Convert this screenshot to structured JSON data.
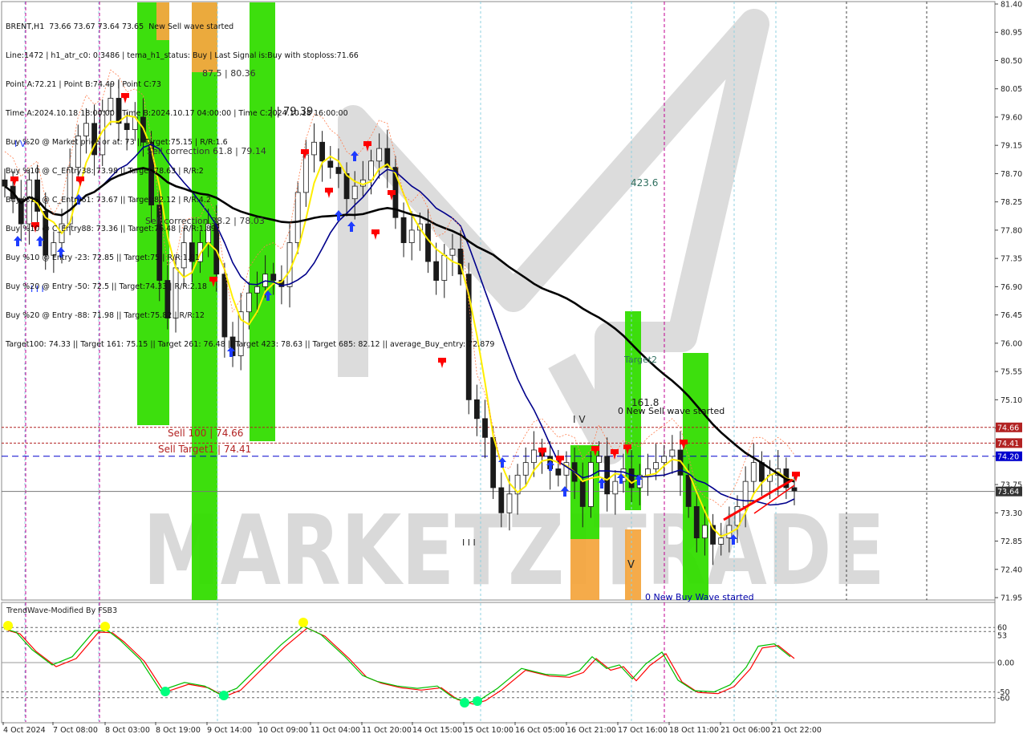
{
  "header": {
    "symbol_line": "BRENT,H1",
    "ohlc_overlay": "73.66 73.67 73.64 73.65",
    "signal_text": "New Sell wave started",
    "info_lines": [
      "Line:1472 | h1_atr_c0: 0.3486 | tema_h1_status: Buy | Last Signal is:Buy with stoploss:71.66",
      "Point A:72.21 | Point B:74.49 | Point C:73",
      "Time A:2024.10.18 18:00:00 | Time B:2024.10.17 04:00:00 | Time C:2024.10.18 16:00:00",
      "Buy %20 @ Market price or at: 73 || Target:75.15 | R/R:1.6",
      "Buy %10 @ C_Entry38: 73.98 || Target:78.63 | R/R:2",
      "Buy %10 @ C_Entry61: 73.67 || Target:82.12 | R/R:4.2",
      "Buy %10 @ C_Entry88: 73.36 || Target:76.48 | R/R:1.89",
      "Buy %10 @ Entry -23: 72.85 || Target:75 | R/R:1.81",
      "Buy %20 @ Entry -50: 72.5 || Target:74.33 | R/R:2.18",
      "Buy %20 @ Entry -88: 71.98 || Target:75.82 | R/R:12",
      "Target100: 74.33 || Target 161: 75.15 || Target 261: 76.48 || Target 423: 78.63 || Target 685: 82.12 || average_Buy_entry: 72.879"
    ]
  },
  "annotations": {
    "a1": "87.5 | 80.36",
    "a2": "| | 79.39",
    "a3": "Sell correction 61.8 | 79.14",
    "a4": "Sell correction 38.2 | 78.03",
    "a5": "423.6",
    "a6": "Target2",
    "a7": "161.8",
    "a8": "0 New Sell wave started",
    "a9": "Sell 100 | 74.66",
    "a10": "Sell Target1 | 74.41",
    "a11": "0 New Buy Wave started",
    "a12": "I V",
    "a13": "I I I",
    "a14": "V",
    "a15": "I V",
    "a16": "I I I"
  },
  "watermark": "MARKETZITRADE",
  "indicator": {
    "title": "TrendWave-Modified By FSB3",
    "levels": [
      "60",
      "53",
      "0.00",
      "-50",
      "-60"
    ]
  },
  "colors": {
    "bull_candle": "#1a1a1a",
    "bear_candle": "#1a1a1a",
    "ma_fast": "#ffff00",
    "ma_mid": "#00008b",
    "ma_slow": "#000000",
    "green_zone": "#00cc00",
    "orange_zone": "#f4a640",
    "level_red": "#b22222",
    "level_blue": "#0000cd",
    "osc_green": "#00c000",
    "osc_red": "#ff0000"
  },
  "chart_data": {
    "type": "line",
    "title": "BRENT,H1",
    "y_axis_labels": [
      "81.40",
      "80.95",
      "80.50",
      "80.05",
      "79.60",
      "79.15",
      "78.70",
      "78.25",
      "77.80",
      "77.35",
      "76.90",
      "76.45",
      "76.00",
      "75.55",
      "75.10",
      "74.65",
      "74.20",
      "73.75",
      "73.30",
      "72.85",
      "72.40",
      "71.95"
    ],
    "ylim": [
      71.95,
      81.4
    ],
    "x_axis_labels": [
      "4 Oct 2024",
      "7 Oct 08:00",
      "8 Oct 03:00",
      "8 Oct 19:00",
      "9 Oct 14:00",
      "10 Oct 09:00",
      "11 Oct 04:00",
      "11 Oct 20:00",
      "14 Oct 15:00",
      "15 Oct 10:00",
      "16 Oct 05:00",
      "16 Oct 21:00",
      "17 Oct 16:00",
      "18 Oct 11:00",
      "21 Oct 06:00",
      "21 Oct 22:00"
    ],
    "price_tags": [
      {
        "label": "74.66",
        "value": 74.66,
        "color": "#b22222"
      },
      {
        "label": "74.41",
        "value": 74.41,
        "color": "#b22222"
      },
      {
        "label": "74.20",
        "value": 74.2,
        "color": "#0000cd"
      },
      {
        "label": "73.64",
        "value": 73.64,
        "color": "#333333"
      }
    ],
    "close_series": [
      78.5,
      78.3,
      77.9,
      78.6,
      78.1,
      77.4,
      77.6,
      77.9,
      78.8,
      79.3,
      79.5,
      79.0,
      79.7,
      79.9,
      79.5,
      79.4,
      79.6,
      79.2,
      78.2,
      77.0,
      76.4,
      77.2,
      77.6,
      77.3,
      77.6,
      77.9,
      77.1,
      76.1,
      75.8,
      76.5,
      76.8,
      76.9,
      77.1,
      77.0,
      76.9,
      77.6,
      78.4,
      79.0,
      79.2,
      78.9,
      78.8,
      78.7,
      78.3,
      78.5,
      78.6,
      78.9,
      79.1,
      78.8,
      78.0,
      77.6,
      77.8,
      77.9,
      77.3,
      77.0,
      77.4,
      77.5,
      77.1,
      75.1,
      74.8,
      74.5,
      73.7,
      73.3,
      73.6,
      73.9,
      74.1,
      74.3,
      74.2,
      74.0,
      73.9,
      74.1,
      73.8,
      73.4,
      74.1,
      74.2,
      73.6,
      73.8,
      74.0,
      73.7,
      73.9,
      74.0,
      74.1,
      74.2,
      74.3,
      73.9,
      73.4,
      72.9,
      73.1,
      72.8,
      72.9,
      73.1,
      73.4,
      73.8,
      74.1,
      73.8,
      73.9,
      74.0,
      73.7,
      73.65
    ]
  }
}
